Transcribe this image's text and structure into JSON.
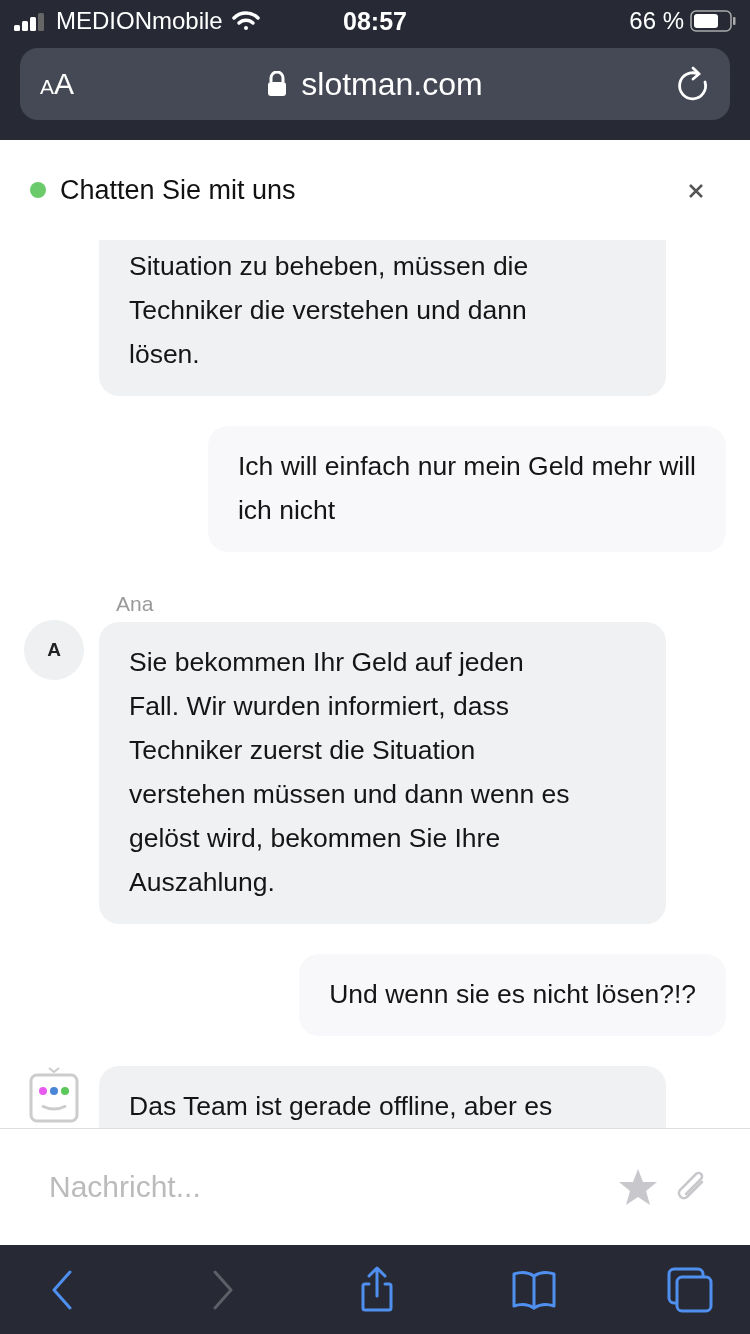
{
  "status_bar": {
    "carrier": "MEDIONmobile",
    "time": "08:57",
    "battery": "66 %"
  },
  "address_bar": {
    "text_size": {
      "small": "A",
      "large": "A"
    },
    "url": "slotman.com"
  },
  "chat": {
    "title": "Chatten Sie mit uns",
    "online": true,
    "messages": [
      {
        "kind": "agent",
        "cut_top": true,
        "lines": [
          "Situation zu beheben, müssen die",
          "Techniker die verstehen und dann",
          "lösen."
        ]
      },
      {
        "kind": "user",
        "lines": [
          "Ich will einfach nur mein Geld mehr will",
          "ich nicht"
        ]
      },
      {
        "kind": "agent",
        "author": "Ana",
        "avatar": "A",
        "lines": [
          "Sie bekommen Ihr Geld auf jeden",
          "Fall. Wir wurden informiert, dass",
          "Techniker zuerst die Situation",
          "verstehen müssen und dann wenn es",
          "gelöst wird, bekommen Sie Ihre",
          "Auszahlung."
        ]
      },
      {
        "kind": "user",
        "lines": [
          "Und wenn sie es nicht lösen?!?"
        ]
      },
      {
        "kind": "bot",
        "cut_bottom": true,
        "lines": [
          "Das Team ist gerade offline, aber es"
        ]
      }
    ],
    "composer": {
      "placeholder": "Nachricht..."
    }
  },
  "toolbar": [
    {
      "kind": "back",
      "disabled": false
    },
    {
      "kind": "forward",
      "disabled": true
    },
    {
      "kind": "share",
      "disabled": false
    },
    {
      "kind": "bookmarks",
      "disabled": false
    },
    {
      "kind": "tabs",
      "disabled": false
    }
  ]
}
